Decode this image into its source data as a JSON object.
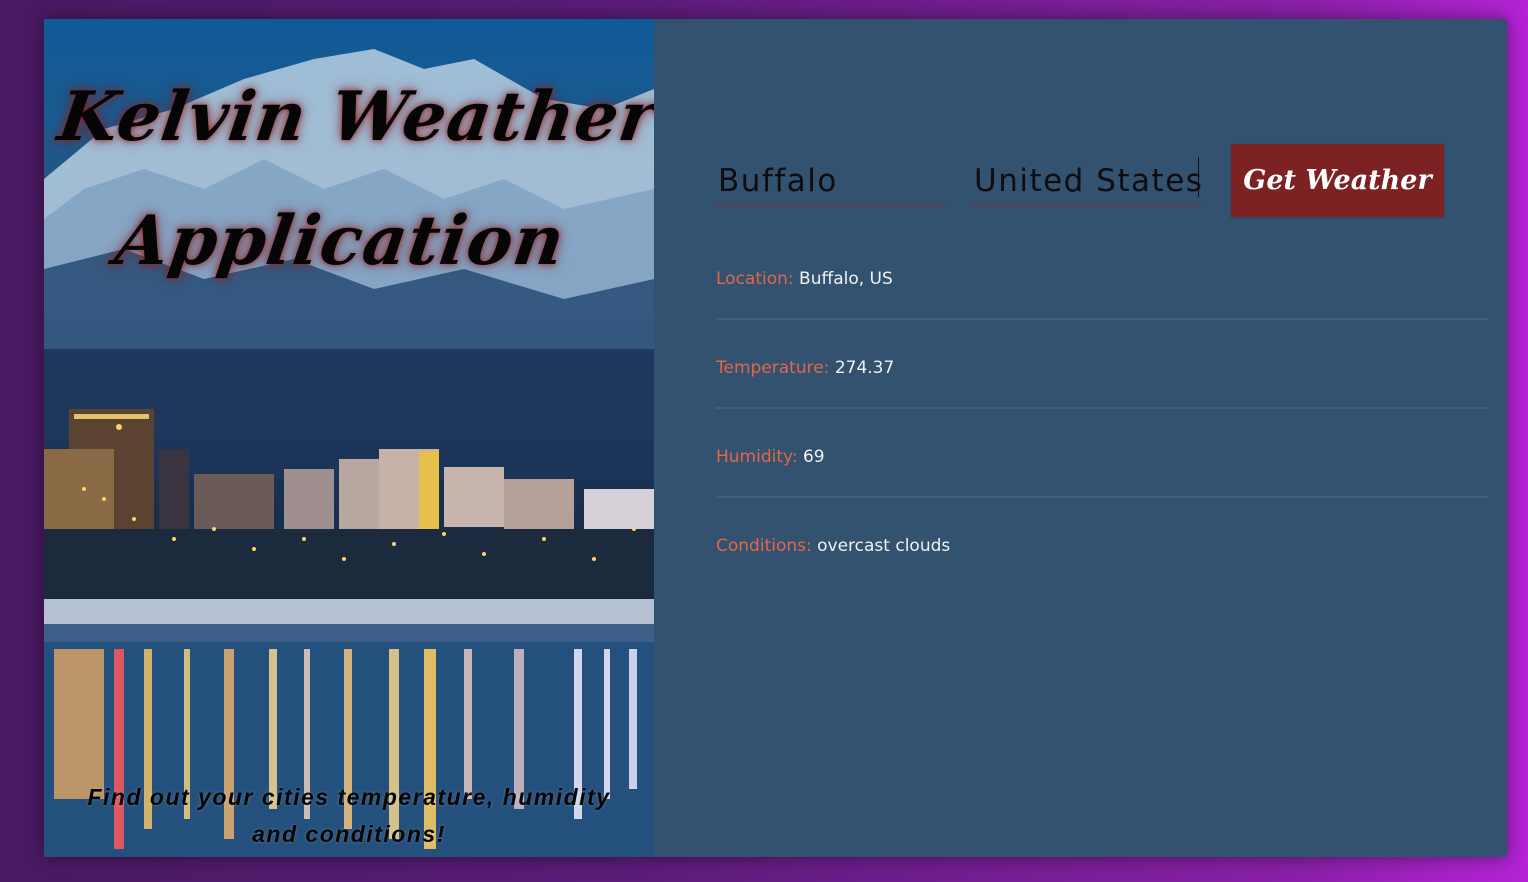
{
  "header": {
    "title_line1": "Kelvin Weather",
    "title_line2": "Application",
    "tagline": "Find out your cities temperature, humidity and conditions!"
  },
  "form": {
    "city_value": "Buffalo",
    "country_value": "United States",
    "submit_label": "Get Weather"
  },
  "results": {
    "location": {
      "label": "Location:",
      "value": "Buffalo, US"
    },
    "temperature": {
      "label": "Temperature:",
      "value": "274.37"
    },
    "humidity": {
      "label": "Humidity:",
      "value": "69"
    },
    "conditions": {
      "label": "Conditions:",
      "value": "overcast clouds"
    }
  },
  "colors": {
    "panel": "#33526f",
    "accent_label": "#e0674a",
    "button": "#7c2222"
  }
}
